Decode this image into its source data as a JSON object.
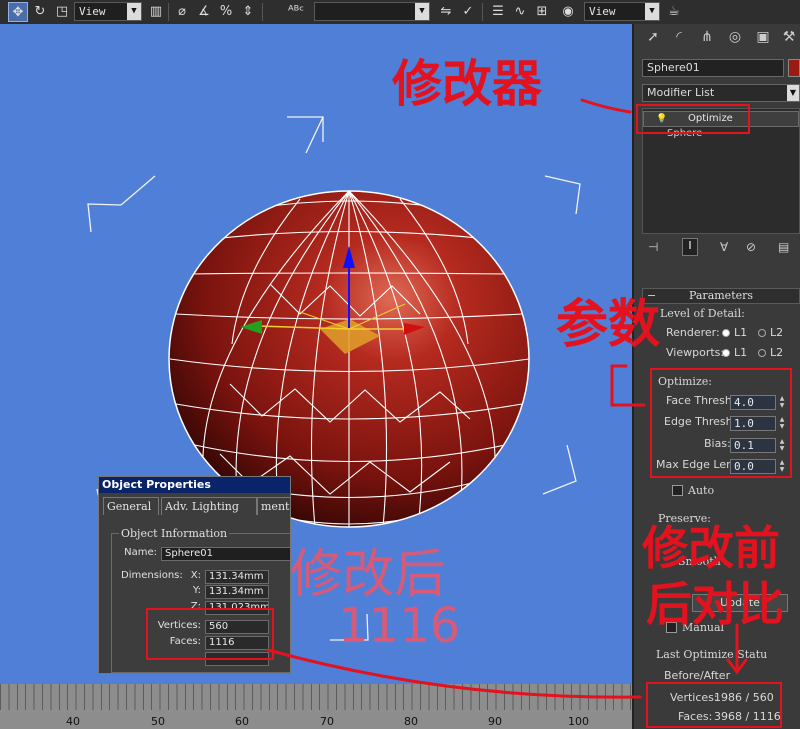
{
  "toolbar": {
    "view_select_1": "View",
    "view_select_2": "View",
    "icons": [
      "select-move-icon",
      "rotate-icon",
      "scale-icon",
      "snap-icon",
      "link-icon",
      "unlink-icon",
      "bind-icon",
      "mirror-icon",
      "align-icon",
      "named-selection-icon",
      "layer-icon",
      "curve-editor-icon",
      "schematic-icon",
      "material-icon",
      "render-icon",
      "teapot-icon"
    ]
  },
  "viewport": {
    "background_color": "#4f7fd6",
    "object_color": "#9b1a14"
  },
  "timeline": {
    "ticks": [
      "40",
      "50",
      "60",
      "70",
      "80",
      "90",
      "100"
    ]
  },
  "command_panel": {
    "tabs": [
      "create-tab",
      "modify-tab",
      "hierarchy-tab",
      "motion-tab",
      "display-tab",
      "utilities-tab"
    ],
    "object_name": "Sphere01",
    "modifier_list": "Modifier List",
    "stack": {
      "top_modifier": "Optimize",
      "base_object": "Sphere"
    },
    "parameters": {
      "rollout_title": "Parameters",
      "level_of_detail": "Level of Detail:",
      "renderer_label": "Renderer:",
      "viewports_label": "Viewports:",
      "l1": "L1",
      "l2": "L2",
      "optimize_label": "Optimize:",
      "face_thresh_label": "Face Thresh:",
      "face_thresh": "4.0",
      "edge_thresh_label": "Edge Thresh:",
      "edge_thresh": "1.0",
      "bias_label": "Bias:",
      "bias": "0.1",
      "max_edge_len_label": "Max Edge Len:",
      "max_edge_len": "0.0",
      "auto_label": "Auto",
      "preserve_label": "Preserve:",
      "smooth_label": "Smooth",
      "update_label": "Update",
      "manual_label": "Manual",
      "last_optimize_status": "Last Optimize Statu",
      "before_after": "Before/After",
      "vertices_label": "Vertices:",
      "vertices_value": "1986 / 560",
      "faces_label": "Faces:",
      "faces_value": "3968 / 1116"
    }
  },
  "object_properties": {
    "title": "Object Properties",
    "tabs": [
      "General",
      "Adv. Lighting",
      "ment"
    ],
    "group": "Object Information",
    "name_label": "Name:",
    "name_value": "Sphere01",
    "dimensions_label": "Dimensions:",
    "x_label": "X:",
    "x_value": "131.34mm",
    "y_label": "Y:",
    "y_value": "131.34mm",
    "z_label": "Z:",
    "z_value": "131.023mm",
    "vertices_label": "Vertices:",
    "vertices_value": "560",
    "faces_label": "Faces:",
    "faces_value": "1116"
  },
  "annotations": {
    "modifier": "修改器",
    "params": "参数",
    "after": "修改后",
    "after_count": "1116",
    "compare_1": "修改前",
    "compare_2": "后对比",
    "color": "#e3121f"
  }
}
